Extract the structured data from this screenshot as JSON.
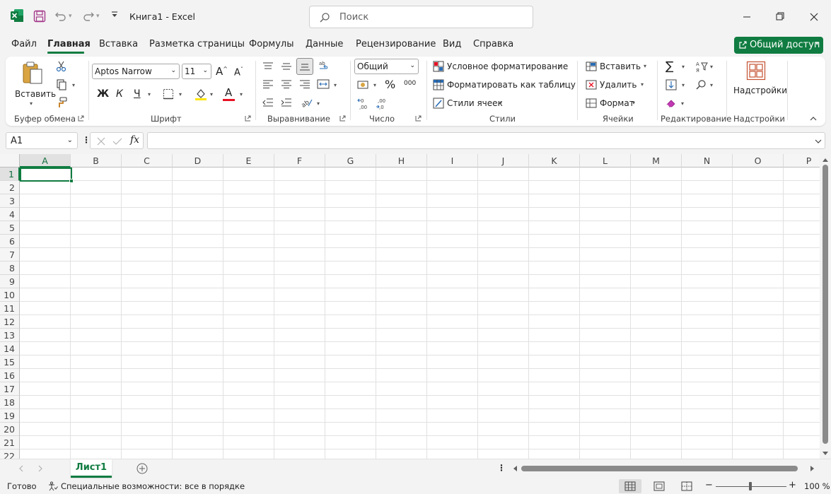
{
  "window": {
    "title": "Книга1  -  Excel",
    "search_placeholder": "Поиск"
  },
  "menu": {
    "items": [
      "Файл",
      "Главная",
      "Вставка",
      "Разметка страницы",
      "Формулы",
      "Данные",
      "Рецензирование",
      "Вид",
      "Справка"
    ],
    "active": "Главная",
    "share_label": "Общий доступ"
  },
  "ribbon": {
    "clipboard": {
      "paste_label": "Вставить",
      "group_label": "Буфер обмена"
    },
    "font": {
      "font_name": "Aptos Narrow",
      "font_size": "11",
      "bold": "Ж",
      "italic": "К",
      "underline": "Ч",
      "group_label": "Шрифт"
    },
    "alignment": {
      "group_label": "Выравнивание"
    },
    "number": {
      "format": "Общий",
      "group_label": "Число"
    },
    "styles": {
      "conditional": "Условное форматирование",
      "format_table": "Форматировать как таблицу",
      "cell_styles": "Стили ячеек",
      "group_label": "Стили"
    },
    "cells": {
      "insert": "Вставить",
      "delete": "Удалить",
      "format": "Формат",
      "group_label": "Ячейки"
    },
    "editing": {
      "group_label": "Редактирование"
    },
    "addins": {
      "button_label": "Надстройки",
      "group_label": "Надстройки"
    }
  },
  "formula_bar": {
    "name_box": "A1",
    "fx": "fx",
    "formula": ""
  },
  "sheet": {
    "columns": [
      "A",
      "B",
      "C",
      "D",
      "E",
      "F",
      "G",
      "H",
      "I",
      "J",
      "K",
      "L",
      "M",
      "N",
      "O",
      "P"
    ],
    "rows": [
      "1",
      "2",
      "3",
      "4",
      "5",
      "6",
      "7",
      "8",
      "9",
      "10",
      "11",
      "12",
      "13",
      "14",
      "15",
      "16",
      "17",
      "18",
      "19",
      "20",
      "21",
      "22"
    ],
    "active_cell": "A1",
    "tab_name": "Лист1"
  },
  "status": {
    "ready": "Готово",
    "accessibility": "Специальные возможности: все в порядке",
    "zoom": "100 %"
  },
  "colors": {
    "accent": "#107c41",
    "gridline": "#e1e1e1"
  }
}
